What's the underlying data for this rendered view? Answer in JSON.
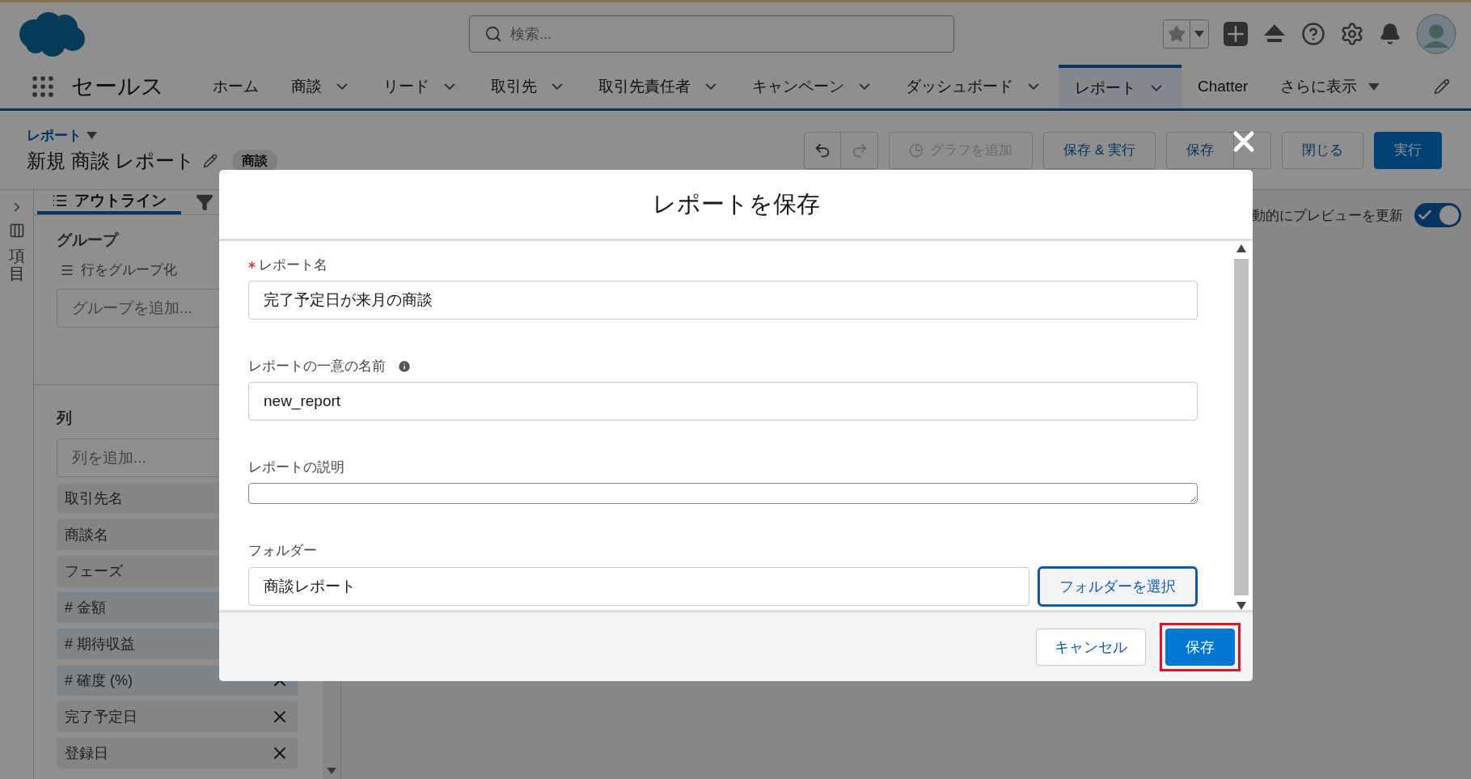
{
  "header": {
    "search_placeholder": "検索..."
  },
  "nav": {
    "app_name": "セールス",
    "tabs": [
      {
        "label": "ホーム",
        "kind": "plain",
        "selected": false
      },
      {
        "label": "商談",
        "kind": "dropdown",
        "selected": false
      },
      {
        "label": "リード",
        "kind": "dropdown",
        "selected": false
      },
      {
        "label": "取引先",
        "kind": "dropdown",
        "selected": false
      },
      {
        "label": "取引先責任者",
        "kind": "dropdown",
        "selected": false
      },
      {
        "label": "キャンペーン",
        "kind": "dropdown",
        "selected": false
      },
      {
        "label": "ダッシュボード",
        "kind": "dropdown",
        "selected": false
      },
      {
        "label": "レポート",
        "kind": "dropdown",
        "selected": true
      },
      {
        "label": "Chatter",
        "kind": "plain",
        "selected": false
      },
      {
        "label": "さらに表示",
        "kind": "more",
        "selected": false
      }
    ]
  },
  "page_header": {
    "breadcrumb": "レポート",
    "title": "新規 商談 レポート",
    "object_badge": "商談",
    "toolbar": [
      {
        "label": "グラフを追加",
        "kind": "chart",
        "disabled": true
      },
      {
        "label": "保存 & 実行",
        "kind": "neutral",
        "disabled": false
      },
      {
        "label": "保存",
        "kind": "split",
        "disabled": false
      },
      {
        "label": "閉じる",
        "kind": "neutral",
        "disabled": false
      },
      {
        "label": "実行",
        "kind": "brand",
        "disabled": false
      }
    ]
  },
  "fields_rail": {
    "label": "項目"
  },
  "outline": {
    "tabs": [
      {
        "kind": "outline",
        "label": "アウトライン",
        "selected": true
      },
      {
        "kind": "filter",
        "selected": false
      }
    ],
    "groups": {
      "heading": "グループ",
      "subheading": "行をグループ化",
      "placeholder": "グループを追加..."
    },
    "columns": {
      "heading": "列",
      "placeholder": "列を追加...",
      "items": [
        {
          "label": "取引先名",
          "kind": "text"
        },
        {
          "label": "商談名",
          "kind": "text"
        },
        {
          "label": "フェーズ",
          "kind": "text"
        },
        {
          "label": "# 金額",
          "kind": "number"
        },
        {
          "label": "# 期待収益",
          "kind": "number"
        },
        {
          "label": "# 確度 (%)",
          "kind": "number",
          "removable": true
        },
        {
          "label": "完了予定日",
          "kind": "text",
          "removable": true
        },
        {
          "label": "登録日",
          "kind": "text",
          "removable": true
        }
      ]
    }
  },
  "preview_toggle": {
    "label": "動的にプレビューを更新",
    "on": true
  },
  "modal": {
    "title": "レポートを保存",
    "fields": [
      {
        "kind": "input",
        "label": "レポート名",
        "required": true,
        "info": false,
        "value": "完了予定日が来月の商談"
      },
      {
        "kind": "input",
        "label": "レポートの一意の名前",
        "required": false,
        "info": true,
        "value": "new_report"
      },
      {
        "kind": "textarea",
        "label": "レポートの説明",
        "required": false,
        "info": false
      },
      {
        "kind": "lookup",
        "label": "フォルダー",
        "required": false,
        "info": false,
        "value": "商談レポート",
        "button": "フォルダーを選択"
      }
    ],
    "buttons": [
      {
        "label": "キャンセル",
        "kind": "neutral",
        "highlighted": false
      },
      {
        "label": "保存",
        "kind": "brand",
        "highlighted": true
      }
    ]
  }
}
